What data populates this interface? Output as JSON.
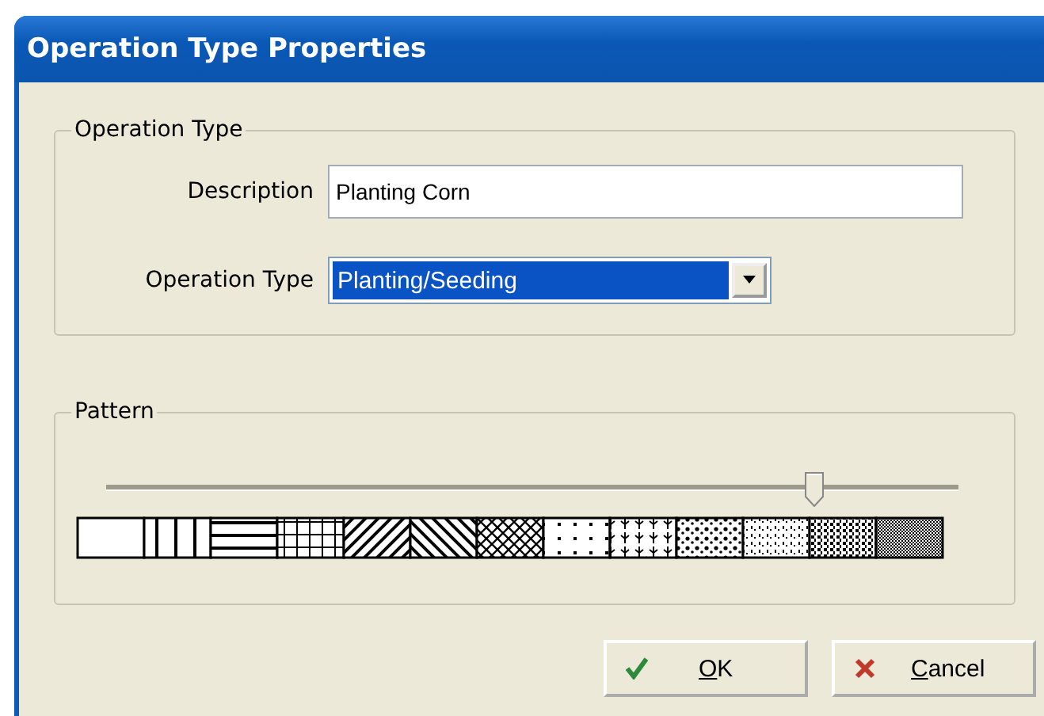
{
  "window": {
    "title": "Operation Type Properties"
  },
  "operation_group": {
    "title": "Operation Type",
    "description": {
      "label": "Description",
      "value": "Planting Corn"
    },
    "operation_type": {
      "label": "Operation Type",
      "value": "Planting/Seeding"
    }
  },
  "pattern_group": {
    "title": "Pattern",
    "slider": {
      "level": 0.83
    }
  },
  "buttons": [
    {
      "label": "OK",
      "kind": "ok"
    },
    {
      "label": "Cancel",
      "kind": "cancel"
    }
  ]
}
